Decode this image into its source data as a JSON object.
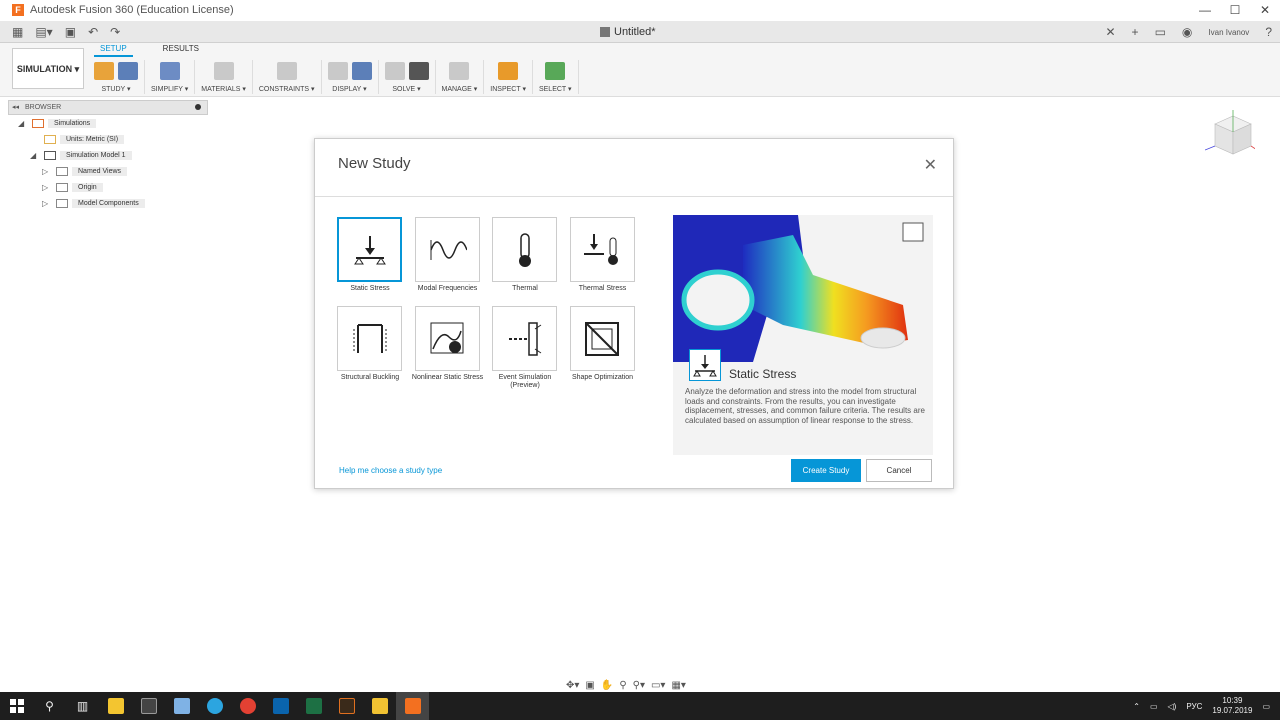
{
  "window": {
    "title": "Autodesk Fusion 360 (Education License)",
    "app_icon_letter": "F",
    "controls": [
      "—",
      "☐",
      "✕"
    ]
  },
  "qat": {
    "doc_title": "Untitled*",
    "close_doc": "✕",
    "user": "Ivan Ivanov"
  },
  "ribbon": {
    "workspace": "SIMULATION ▾",
    "tabs": [
      {
        "label": "SETUP",
        "active": true
      },
      {
        "label": "RESULTS",
        "active": false
      }
    ],
    "groups": [
      {
        "label": "STUDY ▾",
        "icons": [
          "#e8a33a",
          "#5c7fb8"
        ]
      },
      {
        "label": "SIMPLIFY ▾",
        "icons": [
          "#6d8cc4"
        ]
      },
      {
        "label": "MATERIALS ▾",
        "icons": [
          "#c9c9c9"
        ]
      },
      {
        "label": "CONSTRAINTS ▾",
        "icons": [
          "#c9c9c9"
        ]
      },
      {
        "label": "DISPLAY ▾",
        "icons": [
          "#c9c9c9",
          "#5c7fb8"
        ]
      },
      {
        "label": "SOLVE ▾",
        "icons": [
          "#c9c9c9",
          "#555555"
        ]
      },
      {
        "label": "MANAGE ▾",
        "icons": [
          "#c9c9c9"
        ]
      },
      {
        "label": "INSPECT ▾",
        "icons": [
          "#e89a2a"
        ]
      },
      {
        "label": "SELECT ▾",
        "icons": [
          "#58a858"
        ]
      }
    ]
  },
  "browser": {
    "header": "BROWSER",
    "items": [
      {
        "label": "Simulations",
        "indent": 0,
        "tri": "◢"
      },
      {
        "label": "Units: Metric (SI)",
        "indent": 1,
        "tri": ""
      },
      {
        "label": "Simulation Model 1",
        "indent": 1,
        "tri": "◢"
      },
      {
        "label": "Named Views",
        "indent": 2,
        "tri": "▷"
      },
      {
        "label": "Origin",
        "indent": 2,
        "tri": "▷"
      },
      {
        "label": "Model Components",
        "indent": 2,
        "tri": "▷"
      }
    ]
  },
  "dialog": {
    "title": "New Study",
    "close": "✕",
    "studies": [
      {
        "label": "Static Stress",
        "selected": true
      },
      {
        "label": "Modal Frequencies",
        "selected": false
      },
      {
        "label": "Thermal",
        "selected": false
      },
      {
        "label": "Thermal Stress",
        "selected": false
      },
      {
        "label": "Structural Buckling",
        "selected": false
      },
      {
        "label": "Nonlinear Static Stress",
        "selected": false
      },
      {
        "label": "Event Simulation (Preview)",
        "selected": false
      },
      {
        "label": "Shape Optimization",
        "selected": false
      }
    ],
    "preview": {
      "title": "Static Stress",
      "description": "Analyze the deformation and stress into the model from structural loads and constraints. From the results, you can investigate displacement, stresses, and common failure criteria. The results are calculated based on assumption of linear response to the stress."
    },
    "help_link": "Help me choose a study type",
    "create_button": "Create Study",
    "cancel_button": "Cancel"
  },
  "taskbar": {
    "language": "РУС",
    "time": "10:39",
    "date": "19.07.2019"
  },
  "colors": {
    "accent": "#0696d7"
  }
}
